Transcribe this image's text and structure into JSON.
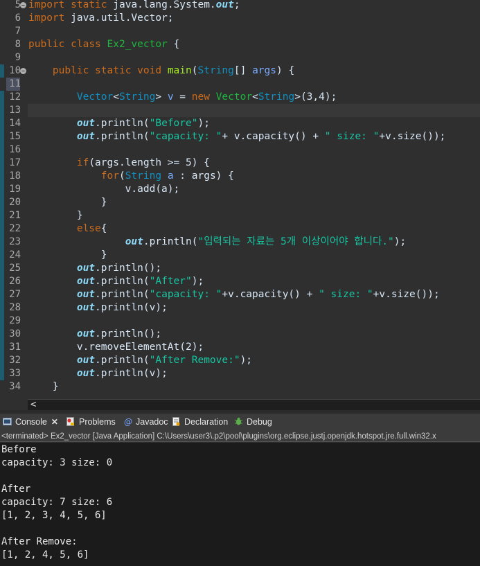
{
  "editor": {
    "lines": [
      {
        "num": "5",
        "parts": [
          [
            "kw",
            "import"
          ],
          [
            "pl",
            " "
          ],
          [
            "kw",
            "static"
          ],
          [
            "pl",
            " java.lang.System."
          ],
          [
            "fd",
            "out"
          ],
          [
            "pl",
            ";"
          ]
        ]
      },
      {
        "num": "6",
        "parts": [
          [
            "kw",
            "import"
          ],
          [
            "pl",
            " java.util.Vector;"
          ]
        ]
      },
      {
        "num": "7",
        "parts": []
      },
      {
        "num": "8",
        "parts": [
          [
            "kw",
            "public"
          ],
          [
            "pl",
            " "
          ],
          [
            "kw",
            "class"
          ],
          [
            "pl",
            " "
          ],
          [
            "cl",
            "Ex2_vector"
          ],
          [
            "pl",
            " {"
          ]
        ]
      },
      {
        "num": "9",
        "parts": []
      },
      {
        "num": "10",
        "parts": [
          [
            "pl",
            "    "
          ],
          [
            "kw",
            "public"
          ],
          [
            "pl",
            " "
          ],
          [
            "kw",
            "static"
          ],
          [
            "pl",
            " "
          ],
          [
            "kw",
            "void"
          ],
          [
            "pl",
            " "
          ],
          [
            "fn",
            "main"
          ],
          [
            "pl",
            "("
          ],
          [
            "ty",
            "String"
          ],
          [
            "pl",
            "[] "
          ],
          [
            "va",
            "args"
          ],
          [
            "pl",
            ") {"
          ]
        ]
      },
      {
        "num": "11",
        "parts": []
      },
      {
        "num": "12",
        "parts": [
          [
            "pl",
            "        "
          ],
          [
            "ty",
            "Vector"
          ],
          [
            "pl",
            "<"
          ],
          [
            "ty",
            "String"
          ],
          [
            "pl",
            "> "
          ],
          [
            "va",
            "v"
          ],
          [
            "pl",
            " = "
          ],
          [
            "kw",
            "new"
          ],
          [
            "pl",
            " "
          ],
          [
            "cl",
            "Vector"
          ],
          [
            "pl",
            "<"
          ],
          [
            "ty",
            "String"
          ],
          [
            "pl",
            ">(3,4);"
          ]
        ]
      },
      {
        "num": "13",
        "parts": []
      },
      {
        "num": "14",
        "parts": [
          [
            "pl",
            "        "
          ],
          [
            "fd",
            "out"
          ],
          [
            "pl",
            ".println("
          ],
          [
            "st",
            "\"Before\""
          ],
          [
            "pl",
            ");"
          ]
        ]
      },
      {
        "num": "15",
        "parts": [
          [
            "pl",
            "        "
          ],
          [
            "fd",
            "out"
          ],
          [
            "pl",
            ".println("
          ],
          [
            "st",
            "\"capacity: \""
          ],
          [
            "pl",
            "+ v.capacity() + "
          ],
          [
            "st",
            "\" size: \""
          ],
          [
            "pl",
            "+v.size());"
          ]
        ]
      },
      {
        "num": "16",
        "parts": []
      },
      {
        "num": "17",
        "parts": [
          [
            "pl",
            "        "
          ],
          [
            "kw",
            "if"
          ],
          [
            "pl",
            "(args.length >= 5) {"
          ]
        ]
      },
      {
        "num": "18",
        "parts": [
          [
            "pl",
            "            "
          ],
          [
            "kw",
            "for"
          ],
          [
            "pl",
            "("
          ],
          [
            "ty",
            "String"
          ],
          [
            "pl",
            " "
          ],
          [
            "va",
            "a"
          ],
          [
            "pl",
            " : args) {"
          ]
        ]
      },
      {
        "num": "19",
        "parts": [
          [
            "pl",
            "                v.add(a);"
          ]
        ]
      },
      {
        "num": "20",
        "parts": [
          [
            "pl",
            "            }"
          ]
        ]
      },
      {
        "num": "21",
        "parts": [
          [
            "pl",
            "        }"
          ]
        ]
      },
      {
        "num": "22",
        "parts": [
          [
            "pl",
            "        "
          ],
          [
            "kw",
            "else"
          ],
          [
            "pl",
            "{"
          ]
        ]
      },
      {
        "num": "23",
        "parts": [
          [
            "pl",
            "                "
          ],
          [
            "fd",
            "out"
          ],
          [
            "pl",
            ".println("
          ],
          [
            "st",
            "\"입력되는 자료는 5개 이상이어야 합니다.\""
          ],
          [
            "pl",
            ");"
          ]
        ]
      },
      {
        "num": "24",
        "parts": [
          [
            "pl",
            "            }"
          ]
        ]
      },
      {
        "num": "25",
        "parts": [
          [
            "pl",
            "        "
          ],
          [
            "fd",
            "out"
          ],
          [
            "pl",
            ".println();"
          ]
        ]
      },
      {
        "num": "26",
        "parts": [
          [
            "pl",
            "        "
          ],
          [
            "fd",
            "out"
          ],
          [
            "pl",
            ".println("
          ],
          [
            "st",
            "\"After\""
          ],
          [
            "pl",
            ");"
          ]
        ]
      },
      {
        "num": "27",
        "parts": [
          [
            "pl",
            "        "
          ],
          [
            "fd",
            "out"
          ],
          [
            "pl",
            ".println("
          ],
          [
            "st",
            "\"capacity: \""
          ],
          [
            "pl",
            "+v.capacity() + "
          ],
          [
            "st",
            "\" size: \""
          ],
          [
            "pl",
            "+v.size());"
          ]
        ]
      },
      {
        "num": "28",
        "parts": [
          [
            "pl",
            "        "
          ],
          [
            "fd",
            "out"
          ],
          [
            "pl",
            ".println(v);"
          ]
        ]
      },
      {
        "num": "29",
        "parts": []
      },
      {
        "num": "30",
        "parts": [
          [
            "pl",
            "        "
          ],
          [
            "fd",
            "out"
          ],
          [
            "pl",
            ".println();"
          ]
        ]
      },
      {
        "num": "31",
        "parts": [
          [
            "pl",
            "        v.removeElementAt(2);"
          ]
        ]
      },
      {
        "num": "32",
        "parts": [
          [
            "pl",
            "        "
          ],
          [
            "fd",
            "out"
          ],
          [
            "pl",
            ".println("
          ],
          [
            "st",
            "\"After Remove:\""
          ],
          [
            "pl",
            ");"
          ]
        ]
      },
      {
        "num": "33",
        "parts": [
          [
            "pl",
            "        "
          ],
          [
            "fd",
            "out"
          ],
          [
            "pl",
            ".println(v);"
          ]
        ]
      },
      {
        "num": "34",
        "parts": [
          [
            "pl",
            "    }"
          ]
        ]
      }
    ]
  },
  "scroll_arrow": "<",
  "tabs": [
    {
      "label": "Console",
      "icon": "console-icon",
      "active": true
    },
    {
      "label": "Problems",
      "icon": "problems-icon"
    },
    {
      "label": "Javadoc",
      "icon": "javadoc-icon"
    },
    {
      "label": "Declaration",
      "icon": "declaration-icon"
    },
    {
      "label": "Debug",
      "icon": "debug-icon"
    }
  ],
  "close_symbol": "✕",
  "status_text": "<terminated> Ex2_vector [Java Application] C:\\Users\\user3\\.p2\\pool\\plugins\\org.eclipse.justj.openjdk.hotspot.jre.full.win32.x",
  "console_output": [
    "Before",
    "capacity: 3 size: 0",
    "",
    "After",
    "capacity: 7 size: 6",
    "[1, 2, 3, 4, 5, 6]",
    "",
    "After Remove:",
    "[1, 2, 4, 5, 6]"
  ],
  "colors": {
    "editor_bg": "#2f2f2f",
    "keyword": "#cc6c1d",
    "string": "#17c6a3",
    "console_bg": "#1b1b1b"
  }
}
